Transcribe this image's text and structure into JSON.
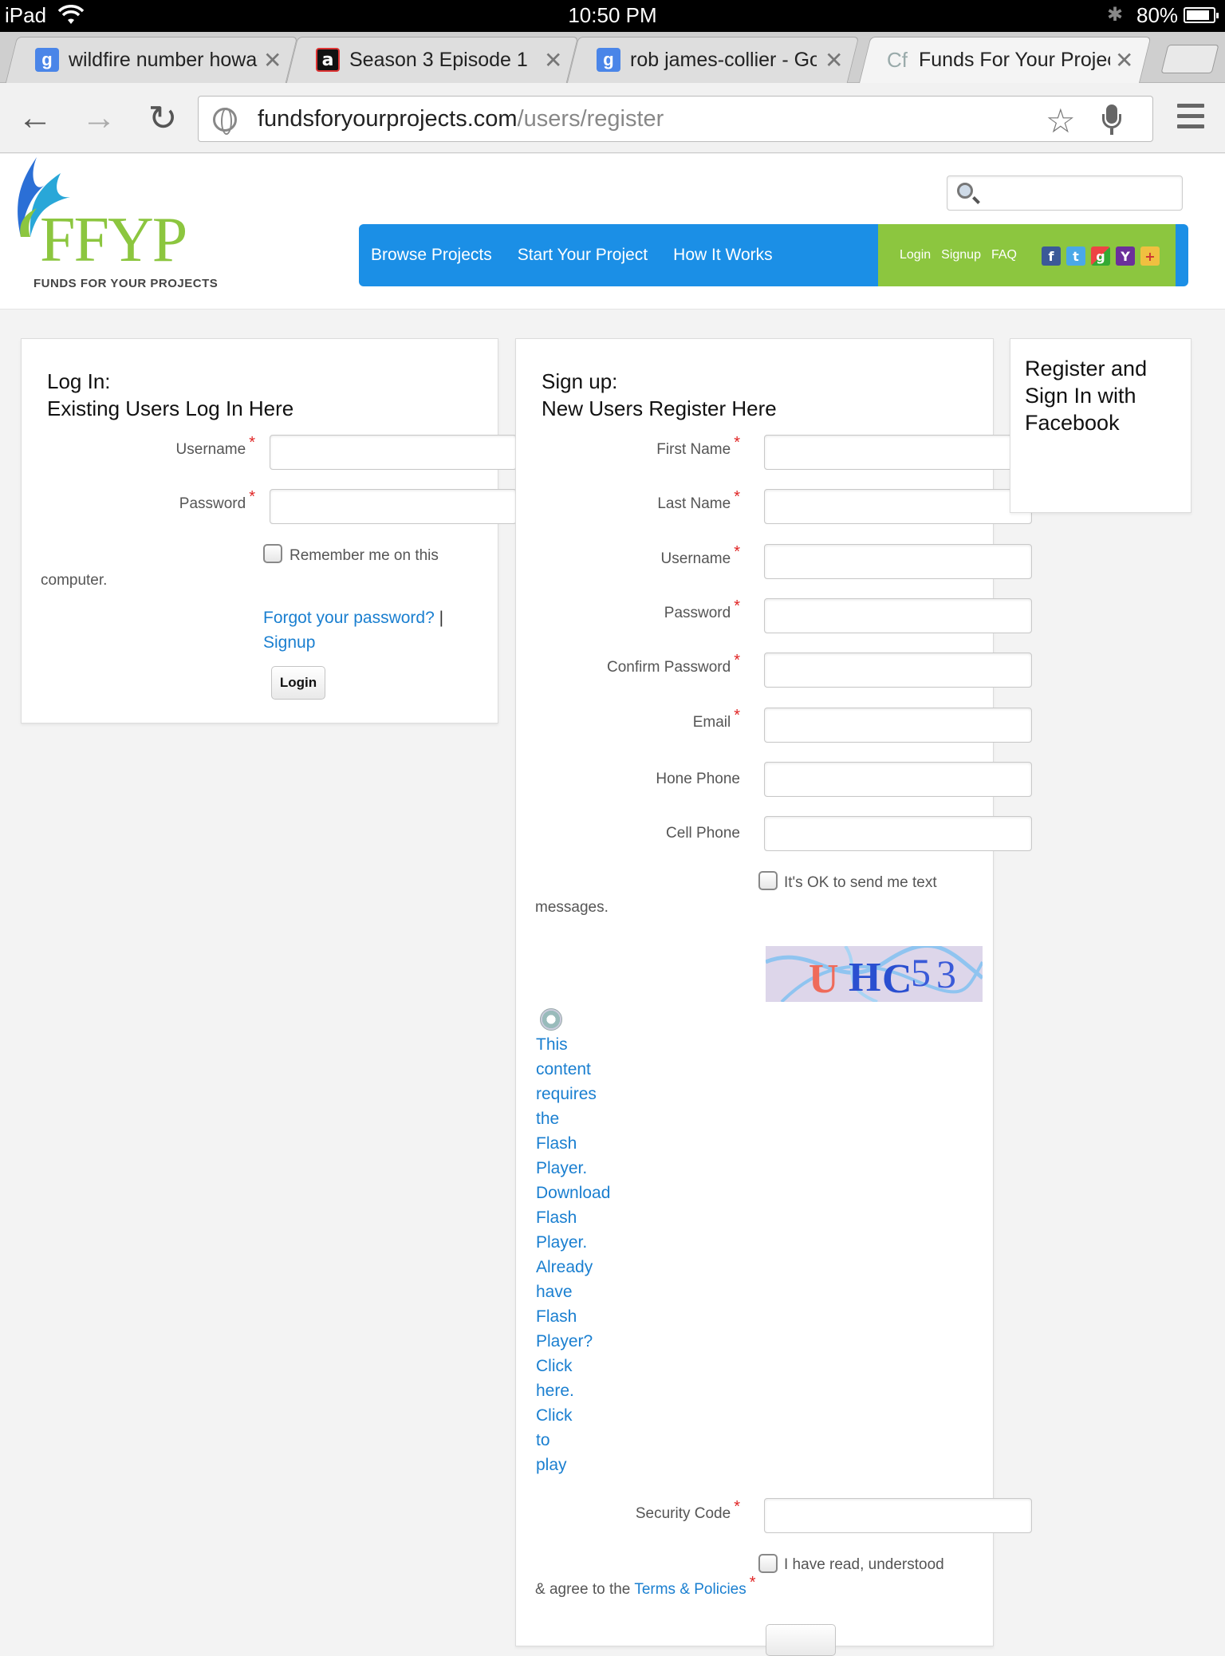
{
  "status_bar": {
    "device": "iPad",
    "time": "10:50 PM",
    "battery": "80%"
  },
  "browser": {
    "tabs": [
      {
        "title": "wildfire number howar",
        "favicon": "g"
      },
      {
        "title": "Season 3 Episode 1",
        "favicon": "a"
      },
      {
        "title": "rob james-collier - Go",
        "favicon": "g"
      },
      {
        "title": "Funds For Your Projec",
        "favicon": "Cf"
      }
    ],
    "active_tab": 3,
    "url_host": "fundsforyourprojects.com",
    "url_path": "/users/register"
  },
  "site": {
    "logo_text": "FFYP",
    "logo_subtitle": "FUNDS FOR YOUR PROJECTS",
    "nav": [
      "Browse Projects",
      "Start Your Project",
      "How It Works"
    ],
    "mini_nav": [
      "Login",
      "Signup",
      "FAQ"
    ],
    "social_icons": [
      "facebook-icon",
      "twitter-icon",
      "google-icon",
      "yahoo-icon",
      "delicious-icon"
    ],
    "colors": {
      "nav_blue": "#1b8fe6",
      "nav_green": "#8cc63f",
      "link": "#1a7fd0",
      "required": "#e02424"
    }
  },
  "login": {
    "heading_1": "Log In:",
    "heading_2": "Existing Users Log In Here",
    "username_label": "Username",
    "password_label": "Password",
    "remember_1": "Remember me on this",
    "remember_2": "computer.",
    "forgot": "Forgot your password?",
    "separator": "|",
    "signup": "Signup",
    "button": "Login"
  },
  "signup": {
    "heading_1": "Sign up:",
    "heading_2": "New Users Register Here",
    "fields": [
      {
        "label": "First Name",
        "required": true
      },
      {
        "label": "Last Name",
        "required": true
      },
      {
        "label": "Username",
        "required": true
      },
      {
        "label": "Password",
        "required": true
      },
      {
        "label": "Confirm Password",
        "required": true
      },
      {
        "label": "Email",
        "required": true
      },
      {
        "label": "Hone Phone",
        "required": false
      },
      {
        "label": "Cell Phone",
        "required": false
      }
    ],
    "text_ok_1": "It's OK to send me text",
    "text_ok_2": "messages.",
    "captcha_text": "UHC53",
    "flash_words": [
      "This",
      "content",
      "requires",
      "the",
      "Flash",
      "Player.",
      "Download",
      "Flash",
      "Player.",
      "Already",
      "have",
      "Flash",
      "Player?",
      "Click",
      "here.",
      "Click",
      "to",
      "play"
    ],
    "security_label": "Security Code",
    "agree_1": "I have read, understood",
    "agree_2": "& agree to the",
    "terms_link": "Terms & Policies"
  },
  "facebook": {
    "line_1": "Register and",
    "line_2": "Sign In with",
    "line_3": "Facebook"
  }
}
